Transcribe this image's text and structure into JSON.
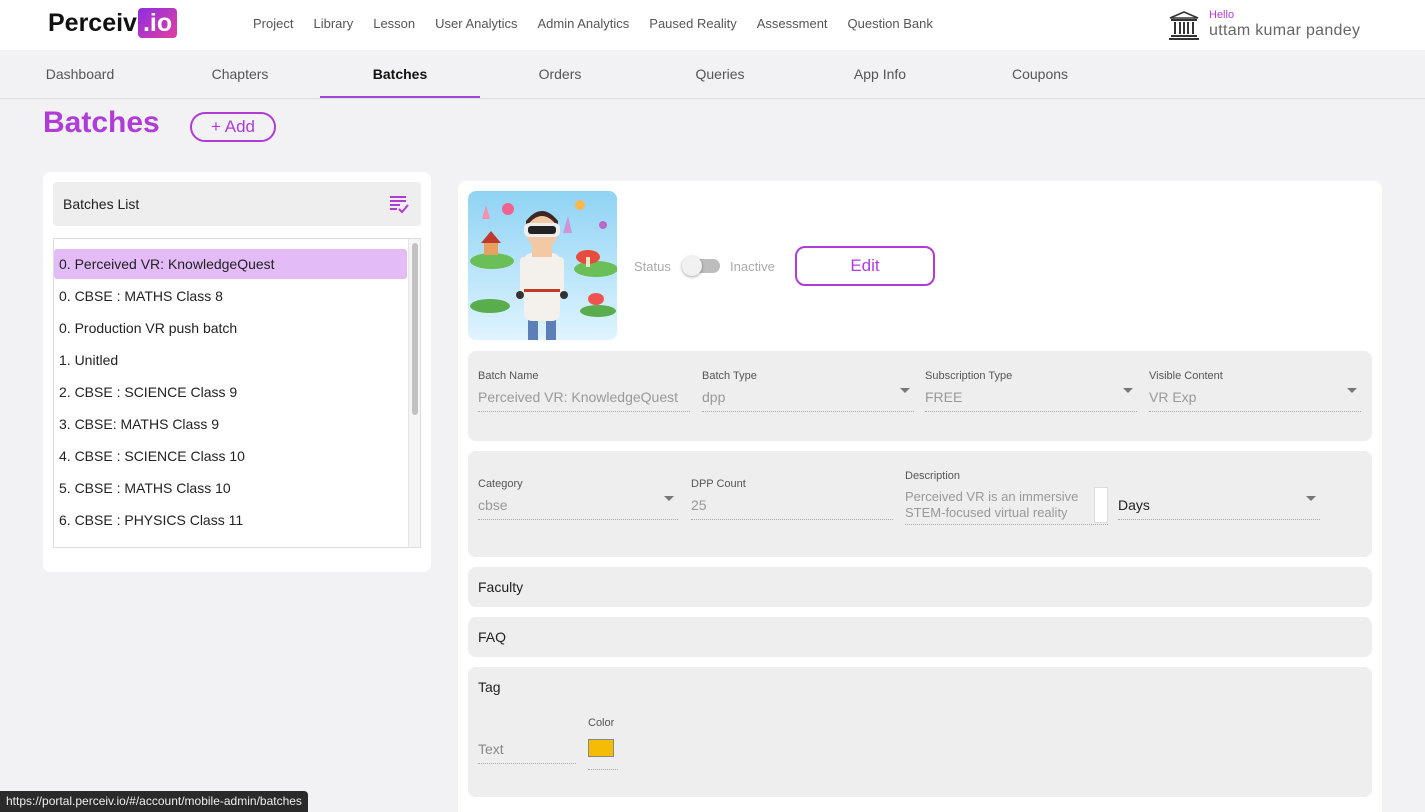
{
  "app": {
    "logo_main": "Perceiv",
    "logo_accent": ".io",
    "brand_color": "#b03cd8"
  },
  "top_nav": [
    "Project",
    "Library",
    "Lesson",
    "User Analytics",
    "Admin Analytics",
    "Paused Reality",
    "Assessment",
    "Question Bank"
  ],
  "user": {
    "greeting": "Hello",
    "name": "uttam kumar pandey",
    "icon": "institution-icon"
  },
  "sub_nav": {
    "tabs": [
      "Dashboard",
      "Chapters",
      "Batches",
      "Orders",
      "Queries",
      "App Info",
      "Coupons"
    ],
    "active": "Batches"
  },
  "page": {
    "title": "Batches",
    "add_label": "+ Add"
  },
  "batches_list": {
    "title": "Batches List",
    "icon": "checklist-icon",
    "selected_index": 0,
    "items": [
      "0. Perceived VR: KnowledgeQuest",
      "0. CBSE : MATHS Class 8",
      "0. Production VR push batch",
      "1. Unitled",
      "2. CBSE : SCIENCE Class 9",
      "3. CBSE: MATHS Class 9",
      "4. CBSE : SCIENCE Class 10",
      "5. CBSE : MATHS Class 10",
      "6. CBSE : PHYSICS Class 11"
    ]
  },
  "batch_detail": {
    "status_label": "Status",
    "status_value": "Inactive",
    "edit_label": "Edit",
    "fields_row1": {
      "batch_name": {
        "label": "Batch Name",
        "value": "Perceived VR: KnowledgeQuest"
      },
      "batch_type": {
        "label": "Batch Type",
        "value": "dpp"
      },
      "subscription_type": {
        "label": "Subscription Type",
        "value": "FREE"
      },
      "visible_content": {
        "label": "Visible Content",
        "value": "VR Exp"
      }
    },
    "fields_row2": {
      "category": {
        "label": "Category",
        "value": "cbse"
      },
      "dpp_count": {
        "label": "DPP Count",
        "value": "25"
      },
      "description": {
        "label": "Description",
        "value": "Perceived VR is an immersive STEM-focused virtual reality"
      },
      "duration_unit": {
        "value": "Days"
      }
    },
    "sections": {
      "faculty": "Faculty",
      "faq": "FAQ",
      "tag": "Tag"
    },
    "tag": {
      "text_placeholder": "Text",
      "color_label": "Color",
      "color_value": "#f5bc06"
    }
  },
  "status_bar": {
    "url": "https://portal.perceiv.io/#/account/mobile-admin/batches"
  }
}
